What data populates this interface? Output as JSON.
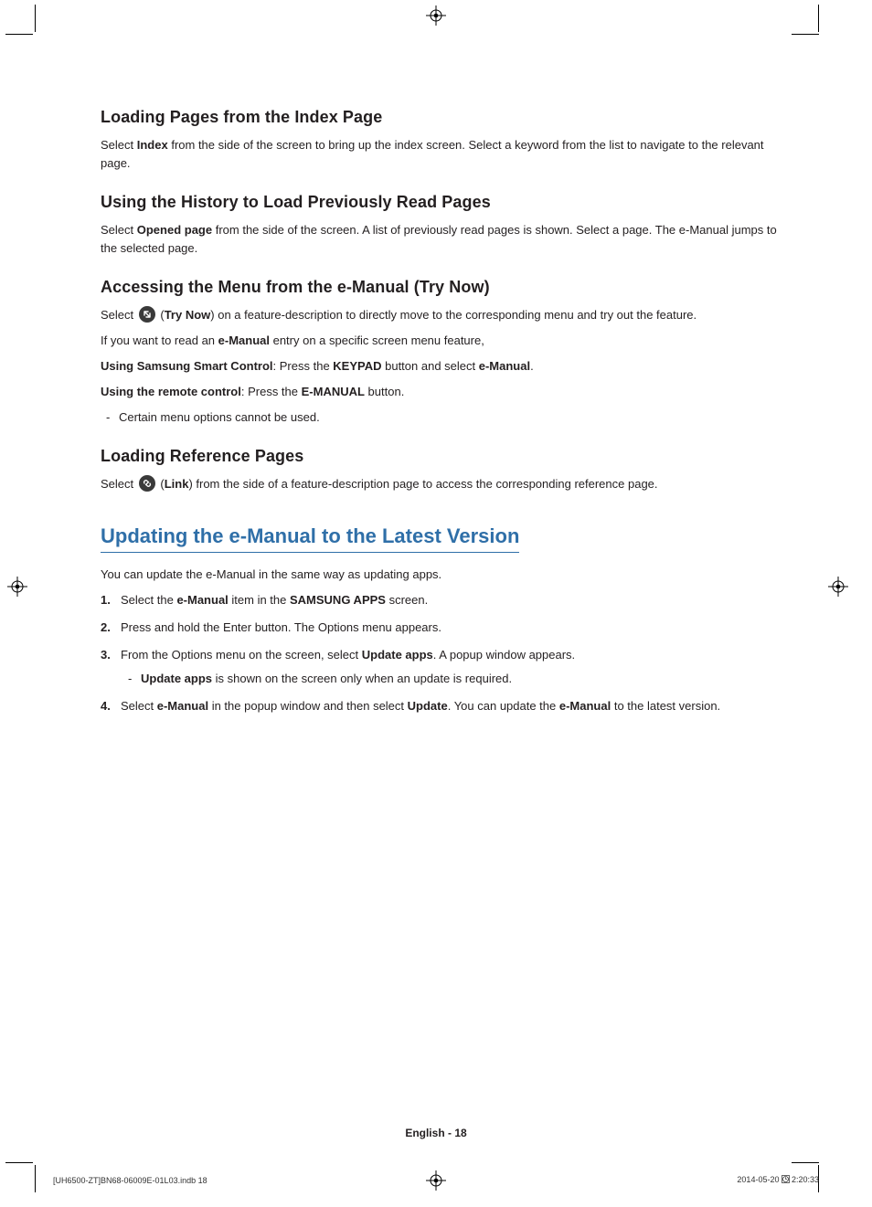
{
  "sections": {
    "s1": {
      "heading": "Loading Pages from the Index Page",
      "p1a": "Select ",
      "p1b": "Index",
      "p1c": " from the side of the screen to bring up the index screen. Select a keyword from the list to navigate to the relevant page."
    },
    "s2": {
      "heading": "Using the History to Load Previously Read Pages",
      "p1a": "Select ",
      "p1b": "Opened page",
      "p1c": " from the side of the screen. A list of previously read pages is shown. Select a page. The e-Manual jumps to the selected page."
    },
    "s3": {
      "heading": "Accessing the Menu from the e-Manual (Try Now)",
      "p1a": "Select ",
      "p1b_label": "Try Now",
      "p1c": ") on a feature-description to directly move to the corresponding menu and try out the feature.",
      "p2a": "If you want to read an ",
      "p2b": "e-Manual",
      "p2c": " entry on a specific screen menu feature,",
      "p3a": "Using Samsung Smart Control",
      "p3b": ": Press the ",
      "p3c": "KEYPAD",
      "p3d": " button and select ",
      "p3e": "e-Manual",
      "p3f": ".",
      "p4a": "Using the remote control",
      "p4b": ": Press the ",
      "p4c": "E-MANUAL",
      "p4d": " button.",
      "note": "Certain menu options cannot be used."
    },
    "s4": {
      "heading": "Loading Reference Pages",
      "p1a": "Select ",
      "p1b_label": "Link",
      "p1c": ") from the side of a feature-description page to access the corresponding reference page."
    }
  },
  "update": {
    "heading": "Updating the e-Manual to the Latest Version",
    "intro": "You can update the e-Manual in the same way as updating apps.",
    "steps": {
      "st1a": "Select the ",
      "st1b": "e-Manual",
      "st1c": " item in the ",
      "st1d": "SAMSUNG APPS",
      "st1e": " screen.",
      "st2": "Press and hold the Enter button. The Options menu appears.",
      "st3a": "From the Options menu on the screen, select ",
      "st3b": "Update apps",
      "st3c": ". A popup window appears.",
      "st3note_a": "Update apps",
      "st3note_b": " is shown on the screen only when an update is required.",
      "st4a": "Select ",
      "st4b": "e-Manual",
      "st4c": " in the popup window and then select ",
      "st4d": "Update",
      "st4e": ". You can update the ",
      "st4f": "e-Manual",
      "st4g": " to the latest version."
    }
  },
  "footer": {
    "page_label": "English - 18",
    "imprint_left": "[UH6500-ZT]BN68-06009E-01L03.indb   18",
    "imprint_date": "2014-05-20   ",
    "imprint_time": "2:20:33"
  }
}
